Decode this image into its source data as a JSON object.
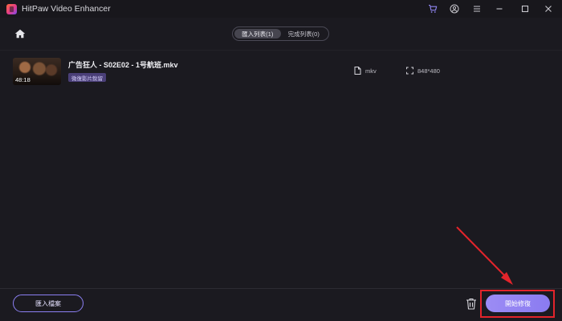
{
  "window": {
    "title": "HitPaw Video Enhancer",
    "icons": [
      "app-logo-icon",
      "cart-icon",
      "account-icon",
      "menu-icon",
      "minimize-icon",
      "maximize-icon",
      "close-icon"
    ]
  },
  "header": {
    "tabs": [
      {
        "label": "匯入列表(1)",
        "active": true
      },
      {
        "label": "完成列表(0)",
        "active": false
      }
    ]
  },
  "files": [
    {
      "duration": "48:18",
      "name": "广告狂人 - S02E02 - 1号航班.mkv",
      "tag": "微復影片銳留",
      "format": "mkv",
      "resolution": "848*480"
    }
  ],
  "footer": {
    "import_label": "匯入檔案",
    "start_label": "開始修復"
  },
  "colors": {
    "background": "#1b1a20",
    "accent": "#8a7bf0",
    "highlight": "#e3242b"
  }
}
